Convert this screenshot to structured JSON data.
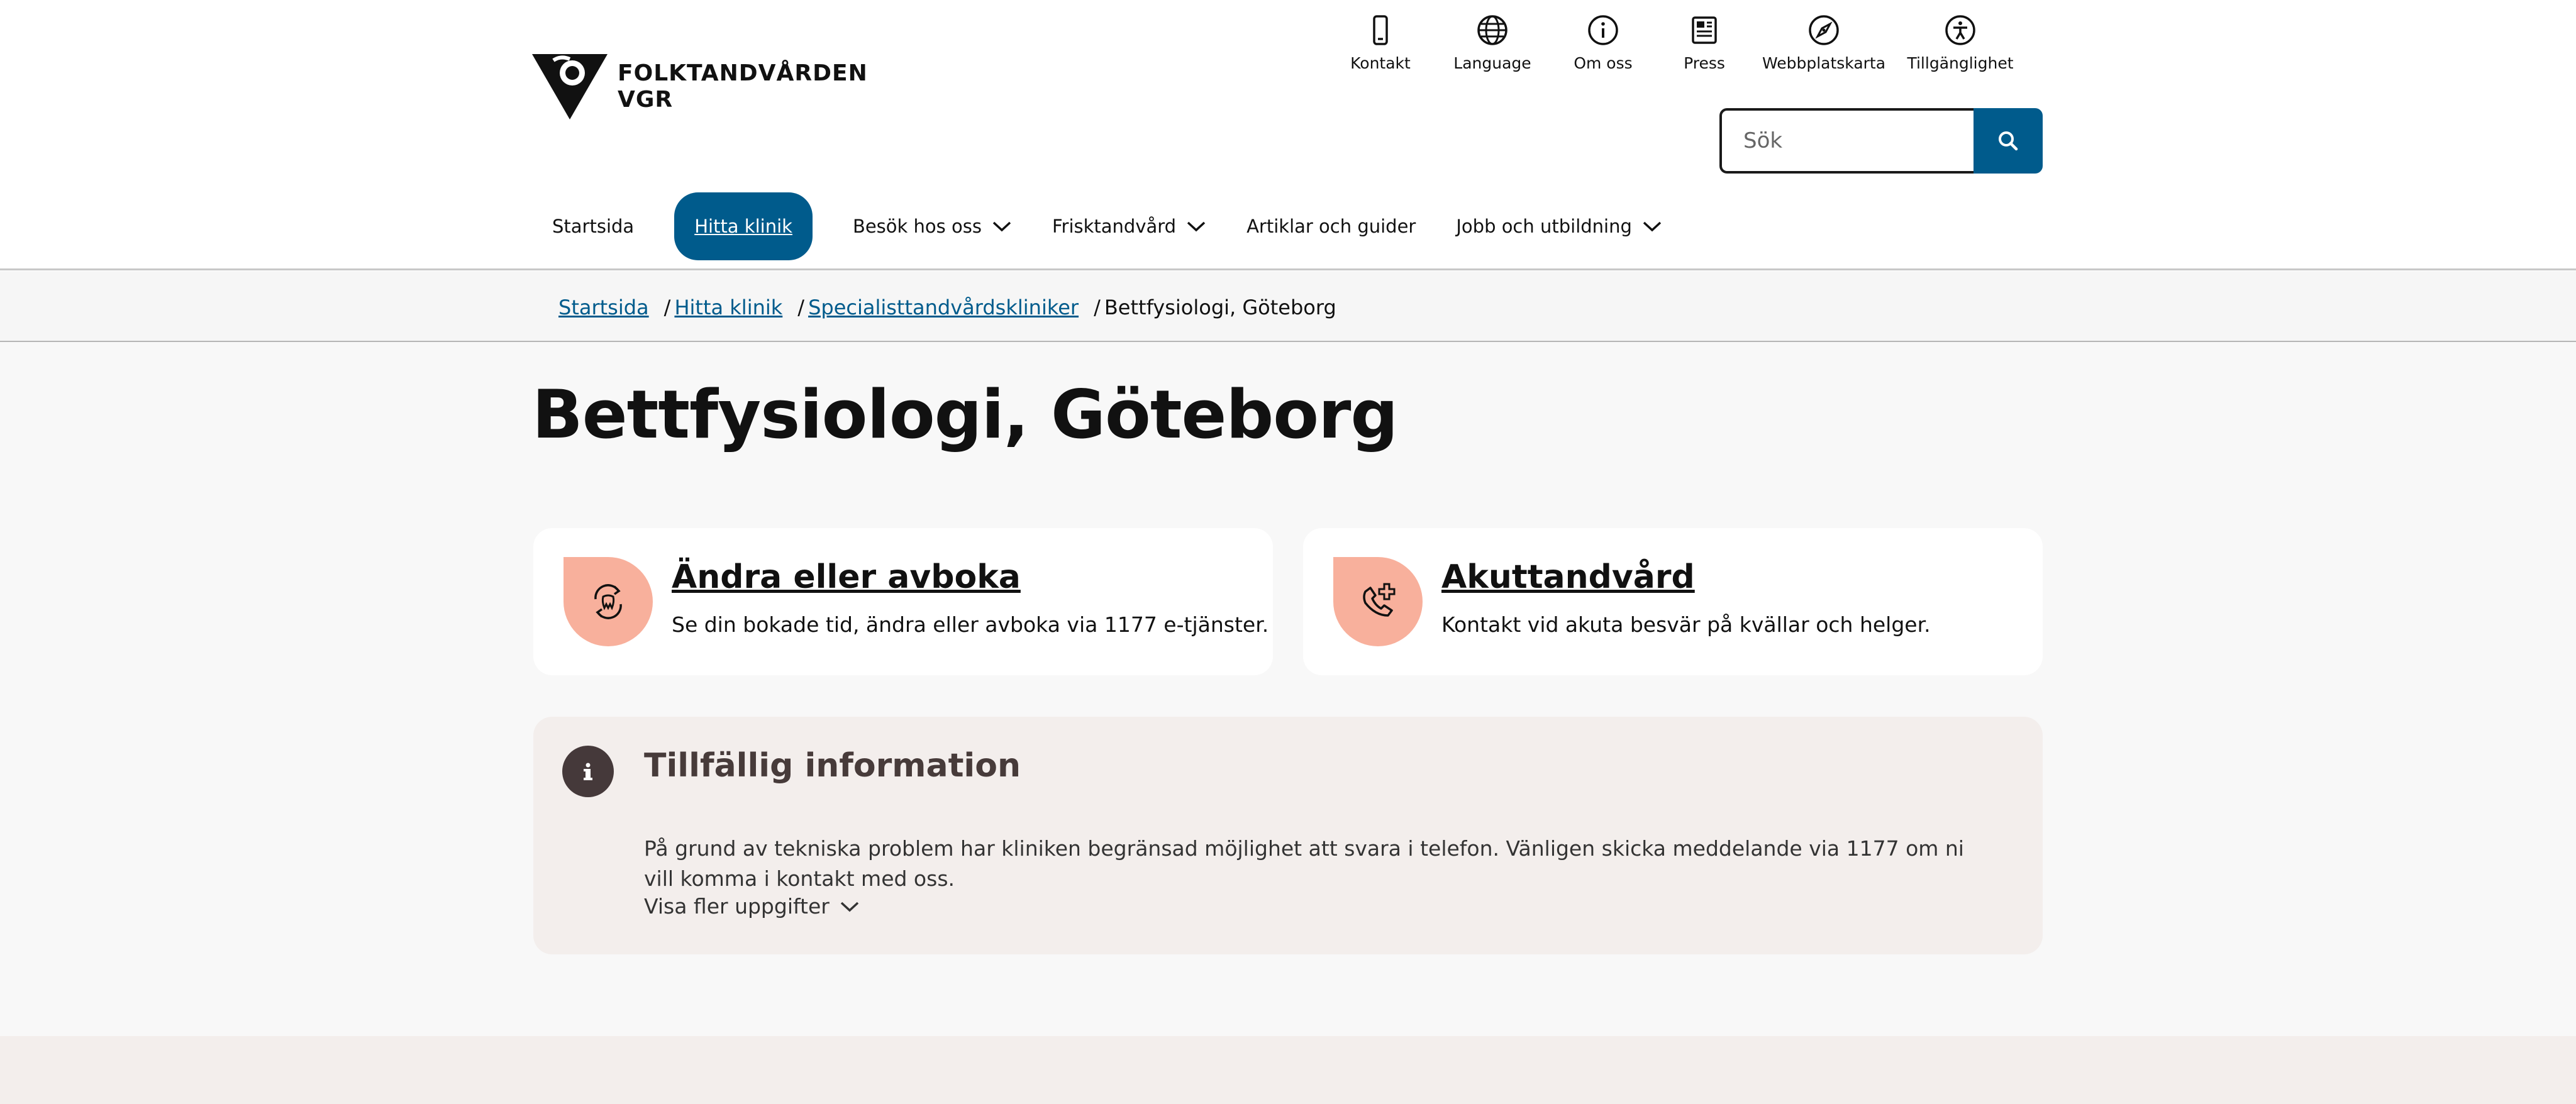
{
  "logo": {
    "line1": "FOLKTANDVÅRDEN",
    "line2": "VGR"
  },
  "utility_nav": [
    {
      "label": "Kontakt",
      "icon": "phone-icon"
    },
    {
      "label": "Language",
      "icon": "globe-icon"
    },
    {
      "label": "Om oss",
      "icon": "info-icon"
    },
    {
      "label": "Press",
      "icon": "newspaper-icon"
    },
    {
      "label": "Webbplatskarta",
      "icon": "compass-icon"
    },
    {
      "label": "Tillgänglighet",
      "icon": "accessibility-icon"
    }
  ],
  "search": {
    "placeholder": "Sök",
    "icon": "search-icon"
  },
  "main_nav": [
    {
      "label": "Startsida"
    },
    {
      "label": "Hitta klinik",
      "active": true
    },
    {
      "label": "Besök hos oss",
      "dropdown": true
    },
    {
      "label": "Frisktandvård",
      "dropdown": true
    },
    {
      "label": "Artiklar och guider"
    },
    {
      "label": "Jobb och utbildning",
      "dropdown": true
    }
  ],
  "breadcrumb": [
    {
      "label": "Startsida",
      "link": true
    },
    {
      "label": "Hitta klinik",
      "link": true
    },
    {
      "label": "Specialisttandvårdskliniker",
      "link": true
    },
    {
      "label": "Bettfysiologi, Göteborg",
      "link": false
    }
  ],
  "page_title": "Bettfysiologi, Göteborg",
  "cards": [
    {
      "title": "Ändra eller avboka",
      "description": "Se din bokade tid, ändra eller avboka via 1177 e-tjänster.",
      "icon": "tooth-refresh-icon"
    },
    {
      "title": "Akuttandvård",
      "description": "Kontakt vid akuta besvär på kvällar och helger.",
      "icon": "phone-plus-icon"
    }
  ],
  "info_box": {
    "title": "Tillfällig information",
    "text": "På grund av tekniska problem har kliniken begränsad möjlighet att svara i telefon. Vänligen skicka meddelande via 1177 om ni vill komma i kontakt med oss.",
    "more_label": "Visa fler uppgifter",
    "icon": "info-icon"
  },
  "colors": {
    "primary": "#005b8c",
    "accent": "#f8b09c",
    "info_bg": "#f3eeec",
    "info_dark": "#45393a"
  }
}
